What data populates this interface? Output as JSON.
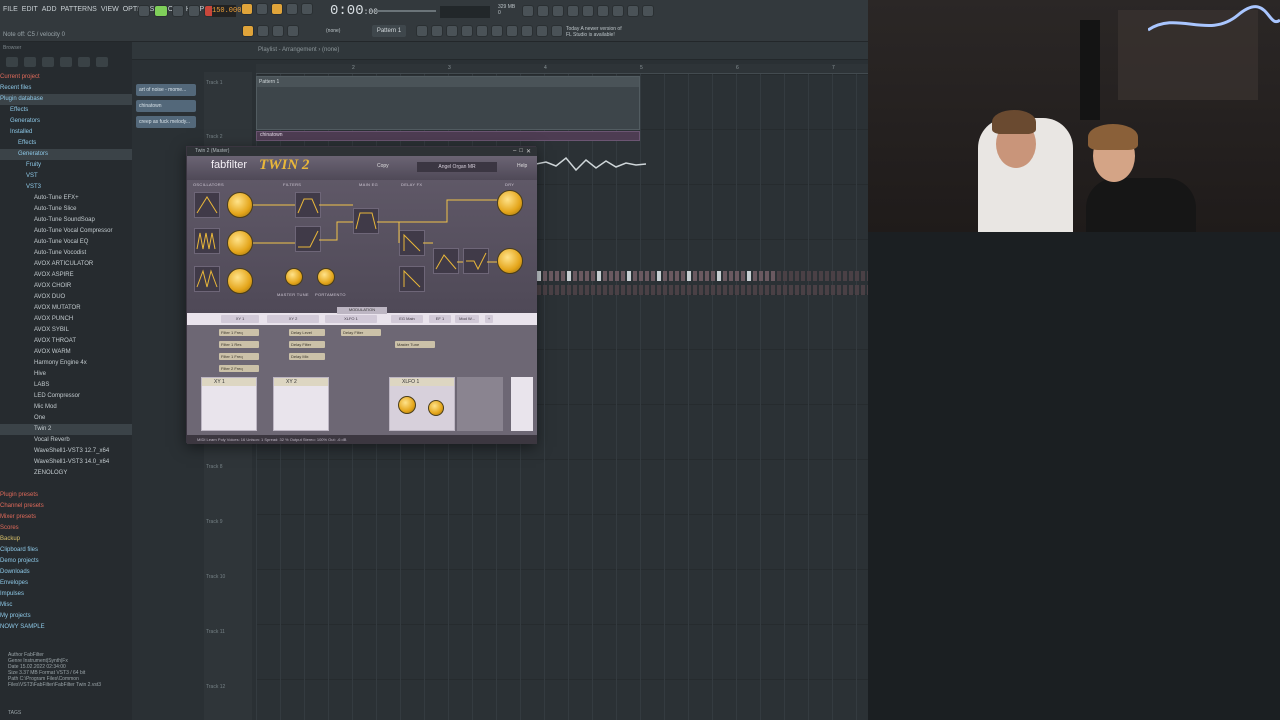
{
  "menu": [
    "FILE",
    "EDIT",
    "ADD",
    "PATTERNS",
    "VIEW",
    "OPTIONS",
    "TOOLS",
    "HELP"
  ],
  "hint": "Note off: C5 / velocity 0",
  "tempo": "150.000",
  "time": "0:00",
  "time_sub": ":00",
  "sysinfo": {
    "cpu": "329 MB",
    "poly": "0"
  },
  "pattern_label": "Pattern 1",
  "none_label": "(none)",
  "news": "Today A newer version of FL Studio is available!",
  "browser": {
    "header": "Browser",
    "items": [
      {
        "label": "Current project",
        "cls": "red"
      },
      {
        "label": "Recent files",
        "cls": "blue"
      },
      {
        "label": "Plugin database",
        "cls": "blue sel"
      },
      {
        "label": "Effects",
        "cls": "blue ind1"
      },
      {
        "label": "Generators",
        "cls": "blue ind1"
      },
      {
        "label": "Installed",
        "cls": "blue ind1"
      },
      {
        "label": "Effects",
        "cls": "blue ind2"
      },
      {
        "label": "Generators",
        "cls": "blue ind2 sel"
      },
      {
        "label": "Fruity",
        "cls": "blue ind3"
      },
      {
        "label": "VST",
        "cls": "blue ind3"
      },
      {
        "label": "VST3",
        "cls": "blue ind3"
      },
      {
        "label": "Auto-Tune EFX+",
        "cls": "plain ind4"
      },
      {
        "label": "Auto-Tune Slice",
        "cls": "plain ind4"
      },
      {
        "label": "Auto-Tune SoundSoap",
        "cls": "plain ind4"
      },
      {
        "label": "Auto-Tune Vocal Compressor",
        "cls": "plain ind4"
      },
      {
        "label": "Auto-Tune Vocal EQ",
        "cls": "plain ind4"
      },
      {
        "label": "Auto-Tune Vocodist",
        "cls": "plain ind4"
      },
      {
        "label": "AVOX ARTICULATOR",
        "cls": "plain ind4"
      },
      {
        "label": "AVOX ASPIRE",
        "cls": "plain ind4"
      },
      {
        "label": "AVOX CHOIR",
        "cls": "plain ind4"
      },
      {
        "label": "AVOX DUO",
        "cls": "plain ind4"
      },
      {
        "label": "AVOX MUTATOR",
        "cls": "plain ind4"
      },
      {
        "label": "AVOX PUNCH",
        "cls": "plain ind4"
      },
      {
        "label": "AVOX SYBIL",
        "cls": "plain ind4"
      },
      {
        "label": "AVOX THROAT",
        "cls": "plain ind4"
      },
      {
        "label": "AVOX WARM",
        "cls": "plain ind4"
      },
      {
        "label": "Harmony Engine 4x",
        "cls": "plain ind4"
      },
      {
        "label": "Hive",
        "cls": "plain ind4"
      },
      {
        "label": "LABS",
        "cls": "plain ind4"
      },
      {
        "label": "LED Compressor",
        "cls": "plain ind4"
      },
      {
        "label": "Mic Mod",
        "cls": "plain ind4"
      },
      {
        "label": "One",
        "cls": "plain ind4"
      },
      {
        "label": "Twin 2",
        "cls": "plain ind4 sel"
      },
      {
        "label": "Vocal Reverb",
        "cls": "plain ind4"
      },
      {
        "label": "WaveShell1-VST3 12.7_x64",
        "cls": "plain ind4"
      },
      {
        "label": "WaveShell1-VST3 14.0_x64",
        "cls": "plain ind4"
      },
      {
        "label": "ZENOLOGY",
        "cls": "plain ind4"
      },
      {
        "label": "",
        "cls": "plain"
      },
      {
        "label": "Plugin presets",
        "cls": "red"
      },
      {
        "label": "Channel presets",
        "cls": "red"
      },
      {
        "label": "Mixer presets",
        "cls": "red"
      },
      {
        "label": "Scores",
        "cls": "red"
      },
      {
        "label": "Backup",
        "cls": "yel"
      },
      {
        "label": "Clipboard files",
        "cls": "blue"
      },
      {
        "label": "Demo projects",
        "cls": "blue"
      },
      {
        "label": "Downloads",
        "cls": "blue"
      },
      {
        "label": "Envelopes",
        "cls": "blue"
      },
      {
        "label": "Impulses",
        "cls": "blue"
      },
      {
        "label": "Misc",
        "cls": "blue"
      },
      {
        "label": "My projects",
        "cls": "blue"
      },
      {
        "label": "NOWY SAMPLE",
        "cls": "blue"
      }
    ],
    "info": {
      "author": "Author  FabFilter",
      "genre": "Genre  Instrument|Synth|Fx",
      "date": "Date  15.02.2022 02:34:00",
      "size": "Size  3.37 MB    Format  VST3 / 64 bit",
      "path": "Path  C:\\Program Files\\Common Files\\VST3\\FabFilter\\FabFilter Twin 2.vst3"
    },
    "status": "TAGS"
  },
  "playlist": {
    "title": "Playlist - Arrangement › (none)",
    "patterns": [
      "art of noise - mome...",
      "chinatown",
      "creep as fuck melody..."
    ],
    "tracks": [
      "Track 1",
      "Track 2",
      "Track 8",
      "Track 9",
      "Track 10",
      "Track 11",
      "Track 12"
    ],
    "clip1": "Pattern 1",
    "clip2": "chinatown",
    "bars": [
      "2",
      "3",
      "4",
      "5",
      "6",
      "7"
    ]
  },
  "plugin": {
    "window_title": "Twin 2 (Master)",
    "brand": "fabfilter",
    "product": "TWIN 2",
    "preset": "Angel Organ MR",
    "copy": "Copy",
    "help": "Help",
    "sections": [
      "OSCILLATORS",
      "FILTERS",
      "MAIN EG",
      "DELAY FX",
      "DRY"
    ],
    "knob_labels": [
      "MASTER TUNE",
      "PORTAMENTO"
    ],
    "mod_label": "MODULATION",
    "mod_tabs": [
      "XY 1",
      "XY 2",
      "XLFO 1",
      "EG Main",
      "EF 1",
      "Mod W..."
    ],
    "slots": [
      "Filter 1 Freq",
      "Filter 1 Res",
      "Filter 1 Freq",
      "Filter 2 Freq",
      "Delay Level",
      "Delay Filter",
      "Delay Mix",
      "Delay Filter",
      "Master Tune"
    ],
    "xy": [
      "XY 1",
      "XY 2",
      "XLFO 1"
    ],
    "footer": "MIDI Learn    Poly    Voices: 16    Unison: 1    Spread: 32 %    Output    Stereo: 100%    Out: -6 dB"
  },
  "colors": {
    "accent": "#e9b73a",
    "fl_orange": "#f0a23a",
    "panel": "#56505c"
  }
}
